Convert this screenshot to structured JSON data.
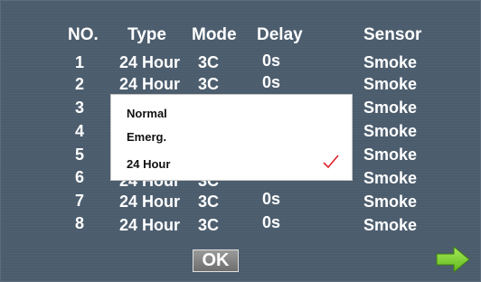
{
  "headers": {
    "no": "NO.",
    "type": "Type",
    "mode": "Mode",
    "delay": "Delay",
    "sensor": "Sensor"
  },
  "rows": [
    {
      "no": "1",
      "type": "24 Hour",
      "mode": "3C",
      "delay": "0s",
      "sensor": "Smoke"
    },
    {
      "no": "2",
      "type": "24 Hour",
      "mode": "3C",
      "delay": "0s",
      "sensor": "Smoke"
    },
    {
      "no": "3",
      "type": "",
      "mode": "",
      "delay": "",
      "sensor": "Smoke"
    },
    {
      "no": "4",
      "type": "",
      "mode": "",
      "delay": "",
      "sensor": "Smoke"
    },
    {
      "no": "5",
      "type": "",
      "mode": "",
      "delay": "",
      "sensor": "Smoke"
    },
    {
      "no": "6",
      "type": "24 Hour",
      "mode": "3C",
      "delay": "",
      "sensor": "Smoke"
    },
    {
      "no": "7",
      "type": "24 Hour",
      "mode": "3C",
      "delay": "0s",
      "sensor": "Smoke"
    },
    {
      "no": "8",
      "type": "24 Hour",
      "mode": "3C",
      "delay": "0s",
      "sensor": "Smoke"
    }
  ],
  "type_dropdown": {
    "options": [
      "Normal",
      "Emerg.",
      "24 Hour"
    ],
    "selected": "24 Hour"
  },
  "buttons": {
    "ok_label": "OK",
    "next_icon": "right-arrow-icon"
  },
  "colors": {
    "background": "#4b5c6d",
    "text": "#ffffff",
    "check": "#e0202a",
    "next_arrow": "#7ed321"
  }
}
